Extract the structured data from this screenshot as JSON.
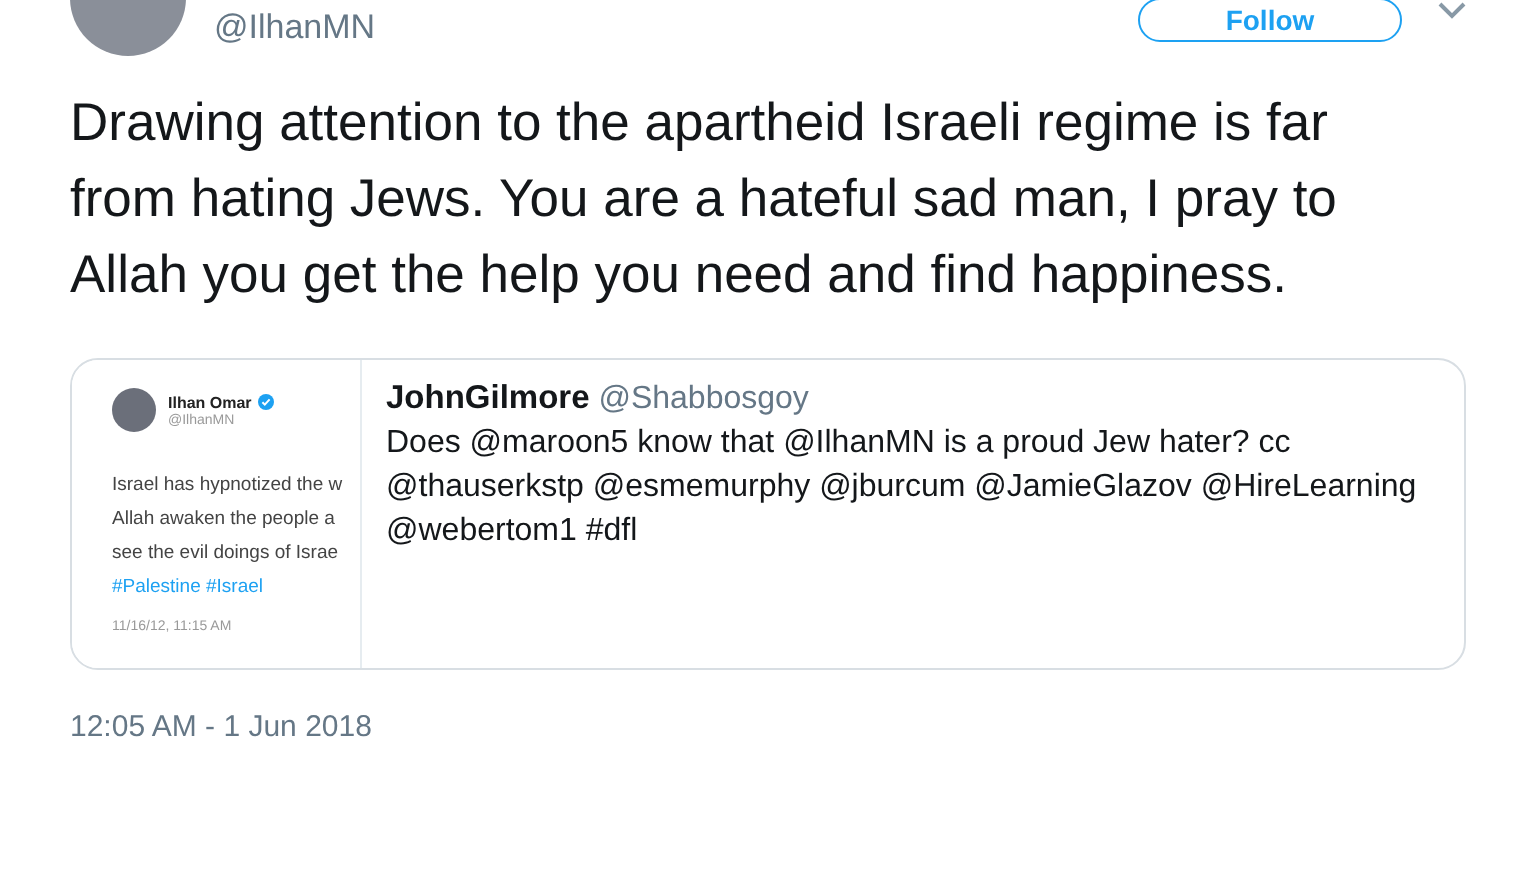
{
  "author": {
    "handle": "@IlhanMN",
    "follow_button": "Follow"
  },
  "tweet_text": "Drawing attention to the apartheid Israeli regime is far from hating Jews. You are a hateful sad man, I pray to Allah you get the help you need and find happiness.",
  "quoted_tweet": {
    "name": "JohnGilmore",
    "handle": "@Shabbosgoy",
    "text": "Does @maroon5 know that @IlhanMN is a proud Jew hater? cc @thauserkstp @esmemurphy @jburcum @JamieGlazov @HireLearning @webertom1 #dfl",
    "image": {
      "name": "Ilhan Omar",
      "handle": "@IlhanMN",
      "verified": true,
      "lines": [
        "Israel has hypnotized the w",
        "Allah awaken the people a",
        "see the evil doings of Israe"
      ],
      "hashtags": "#Palestine #Israel",
      "time": "11/16/12, 11:15 AM"
    }
  },
  "timestamp": "12:05 AM - 1 Jun 2018"
}
